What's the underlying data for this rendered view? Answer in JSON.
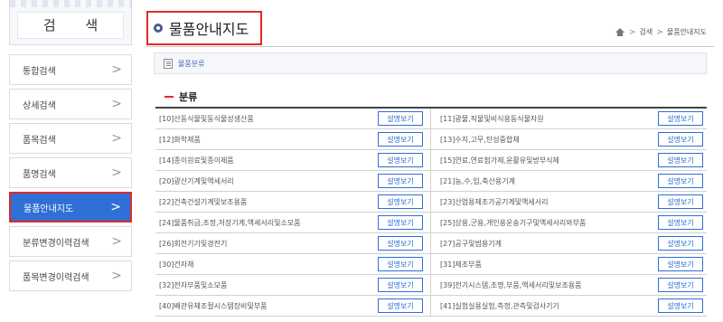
{
  "sidebar": {
    "title": "검 색",
    "items": [
      {
        "label": "통합검색",
        "active": false
      },
      {
        "label": "상세검색",
        "active": false
      },
      {
        "label": "품목검색",
        "active": false
      },
      {
        "label": "품명검색",
        "active": false
      },
      {
        "label": "물품안내지도",
        "active": true
      },
      {
        "label": "분류변경이력검색",
        "active": false
      },
      {
        "label": "품목변경이력검색",
        "active": false
      }
    ],
    "chevron": ">"
  },
  "header": {
    "title": "물품안내지도",
    "breadcrumb": [
      "검색",
      "물품안내지도"
    ],
    "breadcrumb_sep": ">"
  },
  "classify_link": "물품분류",
  "section_title": "분류",
  "button_label": "설명보기",
  "categories": [
    [
      "[10]산동식물및동식물성생산품",
      "[11]광물,직물및비식용동식물자원"
    ],
    [
      "[12]화학제품",
      "[13]수지,고무,탄성중합체"
    ],
    [
      "[14]종이원료및종이제품",
      "[15]연료,연료첨가제,윤활유및방부식제"
    ],
    [
      "[20]광산기계및액세서리",
      "[21]농,수,임,축산용기계"
    ],
    [
      "[22]건축건설기계및보조용품",
      "[23]산업용제조가공기계및액세서리"
    ],
    [
      "[24]물품취급,조정,저장기계,액세서리및소모품",
      "[25]상용,군용,개인용운송기구및액세서리와부품"
    ],
    [
      "[26]회전기기및경전기",
      "[27]공구및범용기계"
    ],
    [
      "[30]건자재",
      "[31]제조부품"
    ],
    [
      "[32]전자부품및소모품",
      "[39]전기시스템,조명,부품,액세서리및보조용품"
    ],
    [
      "[40]배관유체조절시스템장비및부품",
      "[41]실험실용실험,측정,관측및검사기기"
    ]
  ],
  "colors": {
    "accent_blue": "#2f6fd6",
    "highlight_red": "#e02a2a"
  },
  "icons": [
    "home-icon",
    "document-icon",
    "chevron-right-icon",
    "bullet-circle-icon"
  ]
}
